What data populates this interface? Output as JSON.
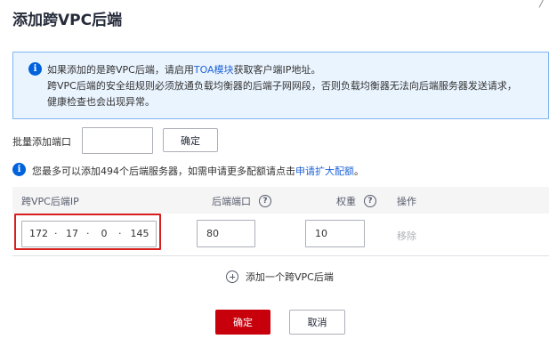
{
  "dialog": {
    "title": "添加跨VPC后端"
  },
  "notice": {
    "line1_prefix": "如果添加的是跨VPC后端，请启用",
    "line1_link": "TOA模块",
    "line1_suffix": "获取客户端IP地址。",
    "line2": "跨VPC后端的安全组规则必须放通负载均衡器的后端子网网段，否则负载均衡器无法向后端服务器发送请求，",
    "line3": "健康检查也会出现异常。"
  },
  "batch": {
    "label": "批量添加端口",
    "input_value": "",
    "confirm_label": "确定"
  },
  "quota": {
    "text": "您最多可以添加494个后端服务器，如需申请更多配额请点击",
    "link": "申请扩大配额",
    "suffix": "。"
  },
  "table": {
    "columns": {
      "ip": "跨VPC后端IP",
      "port": "后端端口",
      "weight": "权重",
      "action": "操作"
    },
    "row": {
      "ip_segments": [
        "172",
        "17",
        "0",
        "145"
      ],
      "port": "80",
      "weight": "10",
      "remove": "移除"
    }
  },
  "add_backend": {
    "label": "添加一个跨VPC后端"
  },
  "footer": {
    "ok": "确定",
    "cancel": "取消"
  },
  "colors": {
    "primary_red": "#c7000b",
    "link_blue": "#2065d6",
    "info_blue": "#0062dc",
    "highlight_red": "#d71f1f"
  }
}
